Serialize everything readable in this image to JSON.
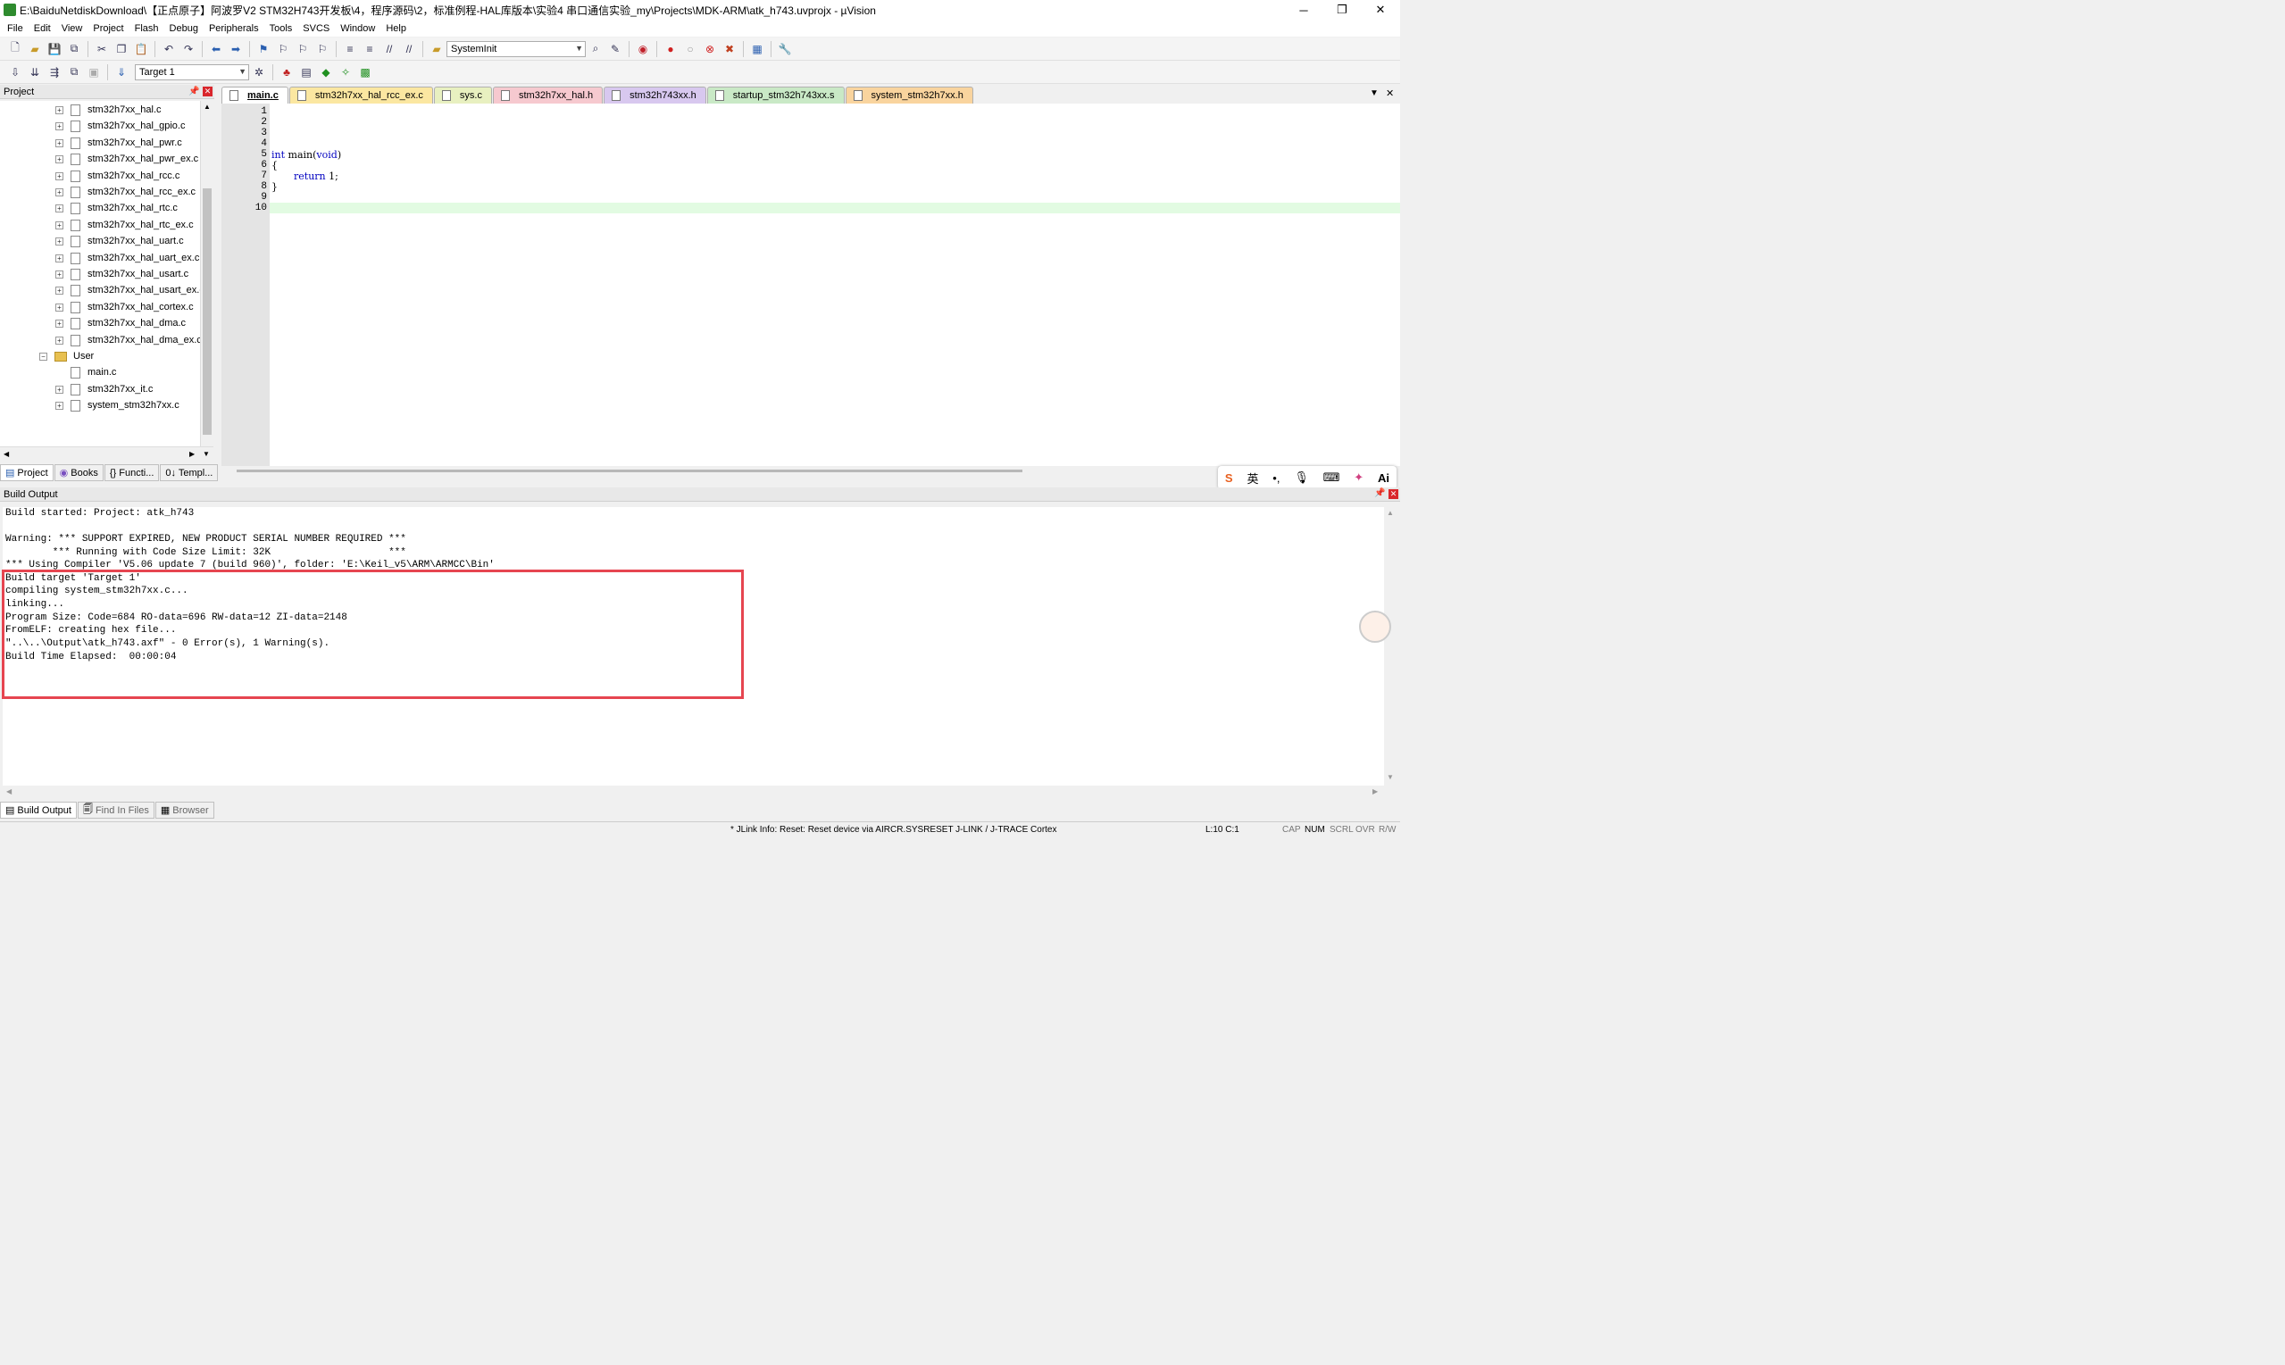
{
  "window": {
    "title": "E:\\BaiduNetdiskDownload\\【正点原子】阿波罗V2 STM32H743开发板\\4，程序源码\\2，标准例程-HAL库版本\\实验4 串口通信实验_my\\Projects\\MDK-ARM\\atk_h743.uvprojx - µVision",
    "minimize": "─",
    "maximize": "❐",
    "close": "✕"
  },
  "menu": [
    "File",
    "Edit",
    "View",
    "Project",
    "Flash",
    "Debug",
    "Peripherals",
    "Tools",
    "SVCS",
    "Window",
    "Help"
  ],
  "toolbar": {
    "function_combo": "SystemInit",
    "target_combo": "Target 1"
  },
  "project_panel": {
    "title": "Project",
    "files": [
      "stm32h7xx_hal.c",
      "stm32h7xx_hal_gpio.c",
      "stm32h7xx_hal_pwr.c",
      "stm32h7xx_hal_pwr_ex.c",
      "stm32h7xx_hal_rcc.c",
      "stm32h7xx_hal_rcc_ex.c",
      "stm32h7xx_hal_rtc.c",
      "stm32h7xx_hal_rtc_ex.c",
      "stm32h7xx_hal_uart.c",
      "stm32h7xx_hal_uart_ex.c",
      "stm32h7xx_hal_usart.c",
      "stm32h7xx_hal_usart_ex.c",
      "stm32h7xx_hal_cortex.c",
      "stm32h7xx_hal_dma.c",
      "stm32h7xx_hal_dma_ex.c"
    ],
    "group": "User",
    "user_files": [
      "main.c",
      "stm32h7xx_it.c",
      "system_stm32h7xx.c"
    ],
    "bottom_tabs": [
      "Project",
      "Books",
      "{} Functi...",
      "0↓ Templ..."
    ]
  },
  "editor_tabs": [
    {
      "label": "main.c",
      "color": "#ffffff"
    },
    {
      "label": "stm32h7xx_hal_rcc_ex.c",
      "color": "#fbe7a1"
    },
    {
      "label": "sys.c",
      "color": "#e8f0c0"
    },
    {
      "label": "stm32h7xx_hal.h",
      "color": "#f6c9cf"
    },
    {
      "label": "stm32h743xx.h",
      "color": "#d8c8ef"
    },
    {
      "label": "startup_stm32h743xx.s",
      "color": "#c9e9c6"
    },
    {
      "label": "system_stm32h7xx.h",
      "color": "#f9d49e"
    }
  ],
  "code": {
    "line_numbers": [
      "1",
      "2",
      "3",
      "4",
      "5",
      "6",
      "7",
      "8",
      "9",
      "10"
    ],
    "line5_kw": "int",
    "line5_mid": " main(",
    "line5_kw2": "void",
    "line5_end": ")",
    "line6": "{",
    "line7_kw": "return",
    "line7_rest": " 1;",
    "line8": "}"
  },
  "build_output": {
    "title": "Build Output",
    "lines": [
      "Build started: Project: atk_h743",
      "",
      "Warning: *** SUPPORT EXPIRED, NEW PRODUCT SERIAL NUMBER REQUIRED ***",
      "        *** Running with Code Size Limit: 32K                    ***",
      "*** Using Compiler 'V5.06 update 7 (build 960)', folder: 'E:\\Keil_v5\\ARM\\ARMCC\\Bin'",
      "Build target 'Target 1'",
      "compiling system_stm32h7xx.c...",
      "linking...",
      "Program Size: Code=684 RO-data=696 RW-data=12 ZI-data=2148",
      "FromELF: creating hex file...",
      "\"..\\..\\Output\\atk_h743.axf\" - 0 Error(s), 1 Warning(s).",
      "Build Time Elapsed:  00:00:04"
    ],
    "bottom_tabs": [
      "Build Output",
      "Find In Files",
      "Browser"
    ]
  },
  "ime": [
    "S",
    "英",
    "•,",
    "🎙",
    "⌨",
    "✦",
    "Ai"
  ],
  "status": {
    "message": "* JLink Info: Reset: Reset device via AIRCR.SYSRESET J-LINK / J-TRACE Cortex",
    "position": "L:10 C:1",
    "flags": [
      "CAP",
      "NUM",
      "SCRL",
      "OVR",
      "R/W"
    ]
  }
}
